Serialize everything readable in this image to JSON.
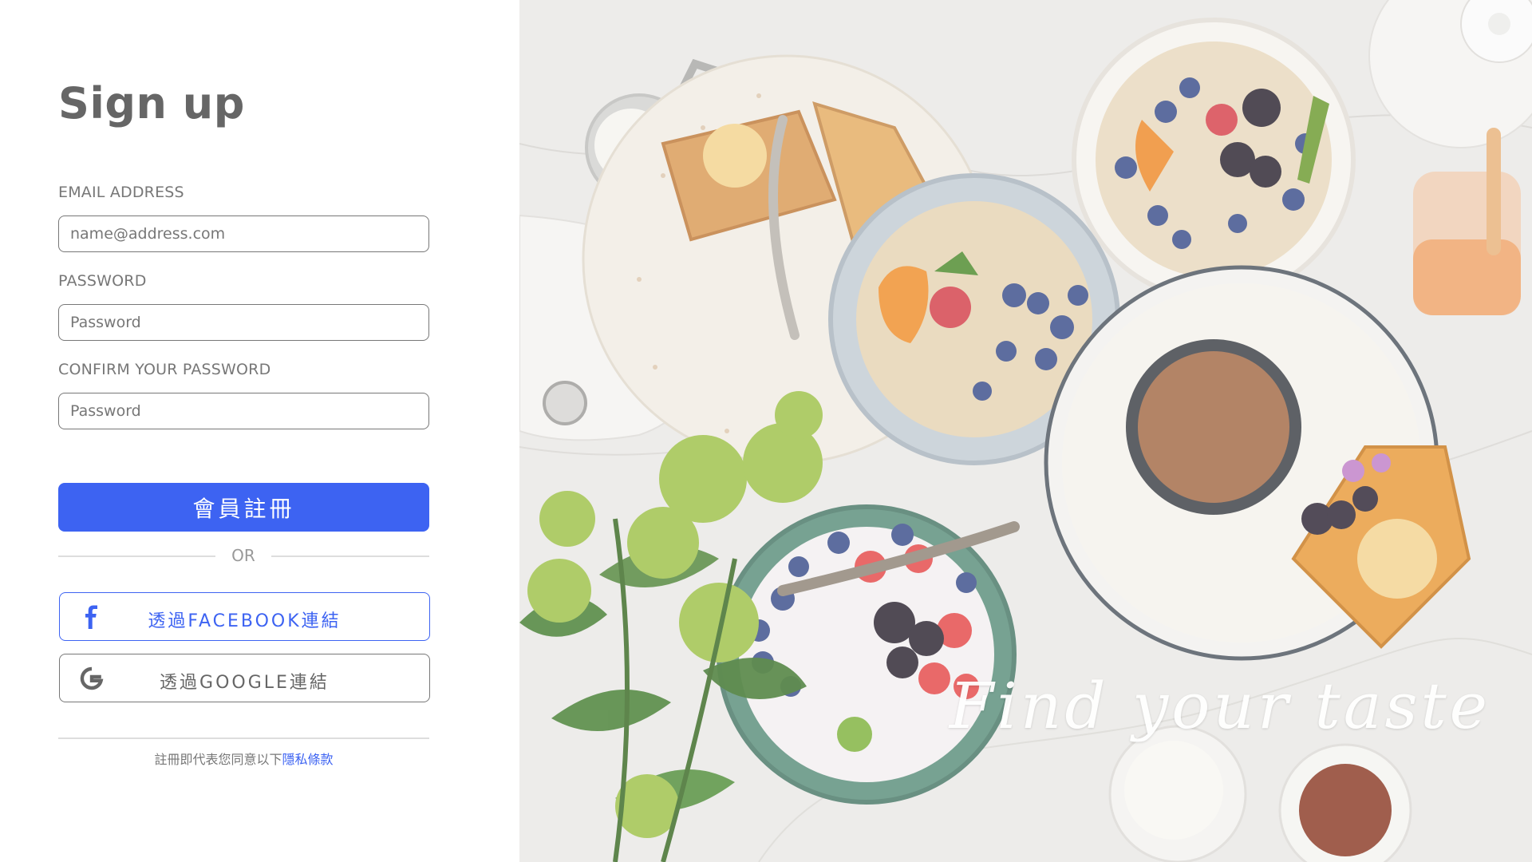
{
  "signup": {
    "title": "Sign up",
    "email_label": "EMAIL ADDRESS",
    "email_placeholder": "name@address.com",
    "password_label": "PASSWORD",
    "password_placeholder": "Password",
    "confirm_label": "CONFIRM YOUR PASSWORD",
    "confirm_placeholder": "Password",
    "submit_label": "會員註冊",
    "or_text": "OR",
    "facebook_label": "透過FACEBOOK連結",
    "google_label": "透過GOOGLE連結",
    "terms_prefix": "註冊即代表您同意以下",
    "terms_link": "隱私條款"
  },
  "hero": {
    "tagline": "Find your taste"
  },
  "colors": {
    "primary": "#3d63f2",
    "facebook": "#3d63f2",
    "text_gray": "#777777"
  },
  "icons": {
    "facebook": "facebook-icon",
    "google": "google-icon"
  }
}
